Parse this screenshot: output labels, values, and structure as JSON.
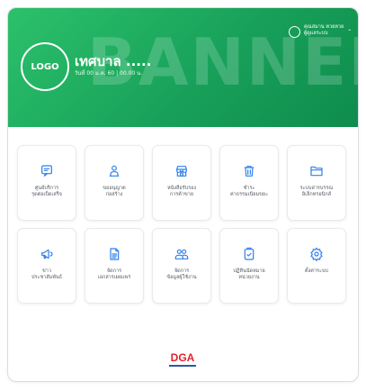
{
  "banner": {
    "watermark": "BANNER",
    "logo_label": "LOGO",
    "org_name": "เทศบาล .....",
    "org_sub": "วันที่ 00 ม.ค. 60 | 00.00 น.",
    "user_name": "คุณสมาน หวยหวย",
    "user_role": "ผู้ดูแลระบบ",
    "user_chevron_icon": "chevron-down-icon"
  },
  "services": [
    {
      "id": "complaint-center",
      "icon": "message-icon",
      "label": "ศูนย์บริการ\nรุดต่อเบ็ดเสร็จ"
    },
    {
      "id": "work-request",
      "icon": "person-icon",
      "label": "ขออนุญาต\nก่อสร้าง"
    },
    {
      "id": "business-license",
      "icon": "shop-icon",
      "label": "หนังสือรับรอง\nการค้าขาย"
    },
    {
      "id": "waste-fee",
      "icon": "trash-icon",
      "label": "ชำระ\nค่าธรรมเนียมขยะ"
    },
    {
      "id": "e-document",
      "icon": "folder-icon",
      "label": "ระบบสารบรรณ\nอิเล็กทรอนิกส์"
    },
    {
      "id": "news",
      "icon": "megaphone-icon",
      "label": "ข่าว\nประชาสัมพันธ์"
    },
    {
      "id": "document-management",
      "icon": "document-icon",
      "label": "จัดการ\nเอกสารเผยแพร่"
    },
    {
      "id": "user-management",
      "icon": "users-icon",
      "label": "จัดการ\nข้อมูลผู้ใช้งาน"
    },
    {
      "id": "agency-approval",
      "icon": "clipboard-check-icon",
      "label": "ปฏิทินนัดหมาย\nหน่วยงาน"
    },
    {
      "id": "settings",
      "icon": "gear-icon",
      "label": "ตั้งค่าระบบ"
    }
  ],
  "footer": {
    "logo_text": "DGA"
  },
  "colors": {
    "banner_green": "#1fa85d",
    "icon_blue": "#2f80ed",
    "dga_red": "#e1232c"
  }
}
